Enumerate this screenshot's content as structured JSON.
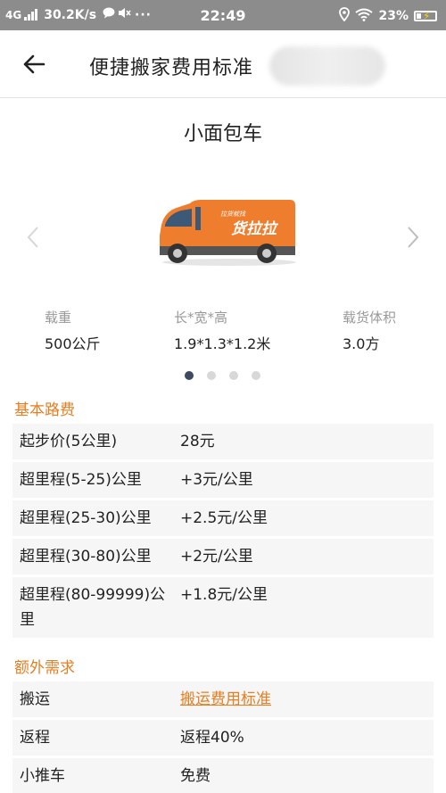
{
  "status_bar": {
    "network": "4G",
    "speed": "30.2K/s",
    "time": "22:49",
    "battery": "23%"
  },
  "app_bar": {
    "title": "便捷搬家费用标准"
  },
  "vehicle": {
    "name": "小面包车",
    "van_brand_text": "货拉拉",
    "van_slogan": "拉货就找",
    "specs": [
      {
        "label": "载重",
        "value": "500公斤"
      },
      {
        "label": "长*宽*高",
        "value": "1.9*1.3*1.2米"
      },
      {
        "label": "载货体积",
        "value": "3.0方"
      }
    ],
    "carousel_total": 4,
    "carousel_active": 1
  },
  "basic_fees": {
    "title": "基本路费",
    "rows": [
      {
        "name": "起步价(5公里)",
        "value": "28元"
      },
      {
        "name": "超里程(5-25)公里",
        "value": "+3元/公里"
      },
      {
        "name": "超里程(25-30)公里",
        "value": "+2.5元/公里"
      },
      {
        "name": "超里程(30-80)公里",
        "value": "+2元/公里"
      },
      {
        "name": "超里程(80-99999)公",
        "name_line2": "里",
        "value": "+1.8元/公里"
      }
    ]
  },
  "extra_fees": {
    "title": "额外需求",
    "rows": [
      {
        "name": "搬运",
        "value": "搬运费用标准"
      },
      {
        "name": "返程",
        "value": "返程40%"
      },
      {
        "name": "小推车",
        "value": "免费"
      }
    ]
  },
  "colors": {
    "accent": "#e67e22",
    "status_bar": "#8c8c8c",
    "row_bg": "#f6f6f6"
  }
}
